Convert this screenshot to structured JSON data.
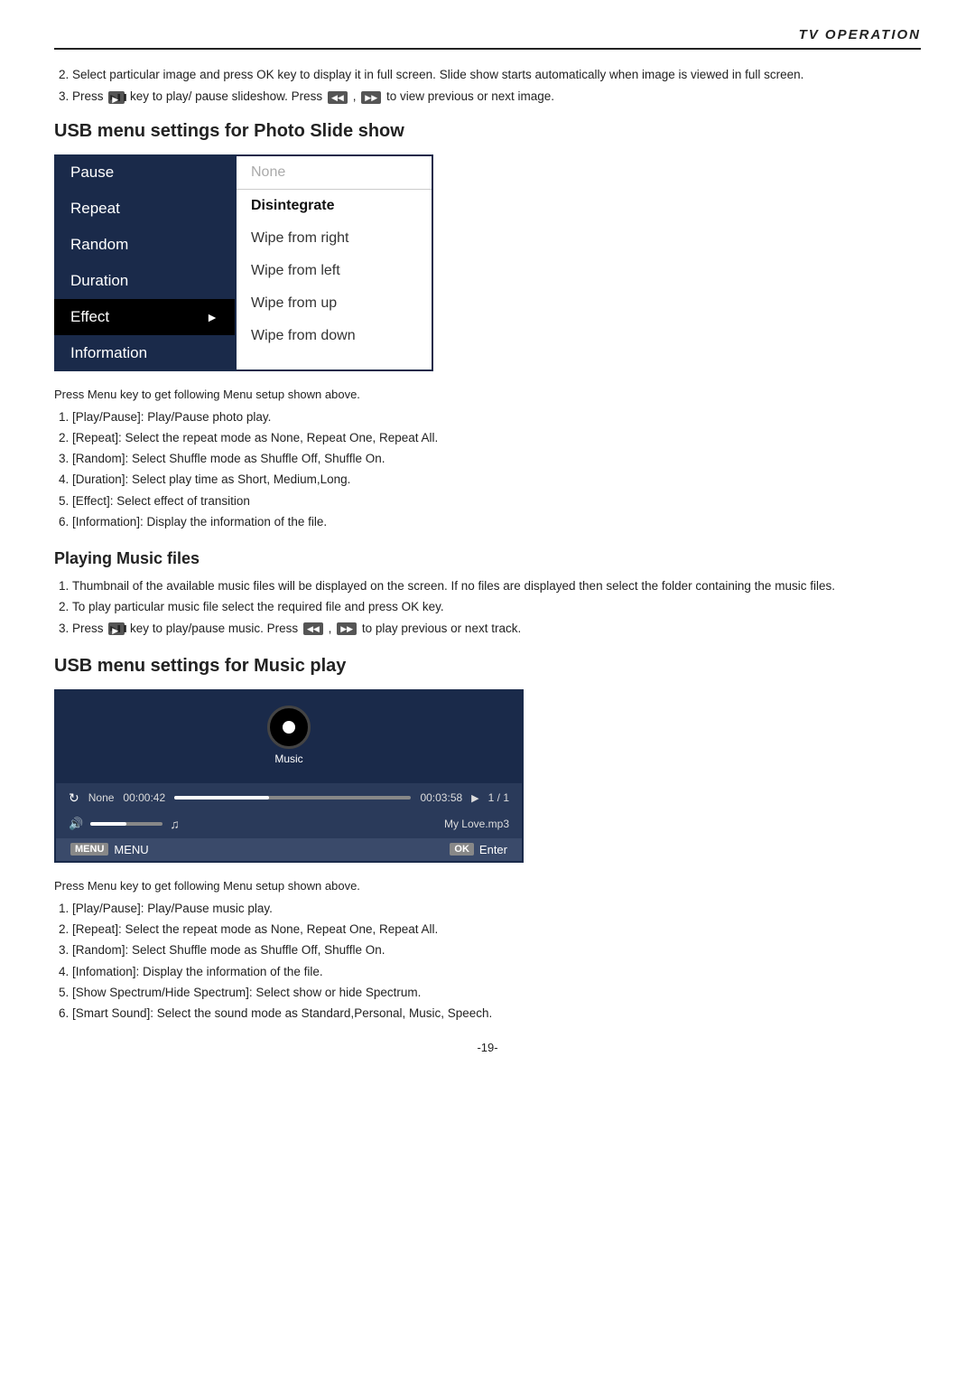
{
  "header": {
    "title": "TV OPERATION"
  },
  "intro": {
    "item2": "Select particular image and press OK key to display it in full screen.\nSlide show starts automatically when image is viewed in full screen.",
    "item3_pre": "Press",
    "item3_mid": "key to play/ pause slideshow. Press",
    "item3_post": "to view previous or next image."
  },
  "photoSection": {
    "title": "USB menu settings for Photo Slide show",
    "menuLeft": [
      {
        "label": "Pause",
        "active": false
      },
      {
        "label": "Repeat",
        "active": false
      },
      {
        "label": "Random",
        "active": false
      },
      {
        "label": "Duration",
        "active": false
      },
      {
        "label": "Effect",
        "active": true
      },
      {
        "label": "Information",
        "active": false
      }
    ],
    "menuRight": [
      {
        "label": "None",
        "type": "header"
      },
      {
        "label": "Disintegrate",
        "type": "selected"
      },
      {
        "label": "Wipe from right",
        "type": "normal"
      },
      {
        "label": "Wipe from left",
        "type": "normal"
      },
      {
        "label": "Wipe from up",
        "type": "normal"
      },
      {
        "label": "Wipe from down",
        "type": "normal"
      }
    ],
    "pressNote": "Press Menu key to get following Menu setup shown above.",
    "instructions": [
      "[Play/Pause]: Play/Pause photo play.",
      "[Repeat]: Select the repeat mode as None, Repeat One, Repeat All.",
      "[Random]: Select Shuffle mode as Shuffle Off, Shuffle On.",
      "[Duration]: Select play time as Short, Medium,Long.",
      "[Effect]: Select effect of transition",
      "[Information]: Display the information of the file."
    ]
  },
  "musicSection": {
    "subTitle": "Playing Music files",
    "items": [
      "Thumbnail of the available music files will be displayed on the screen. If no files are displayed then select the folder containing the music files.",
      "To play particular music file select the required file and press OK key.",
      "Press key to play/pause music. Press , to play previous or next track."
    ],
    "usbTitle": "USB menu settings for Music play",
    "player": {
      "discLabel": "Music",
      "repeatLabel": "None",
      "timeElapsed": "00:00:42",
      "timeDuration": "00:03:58",
      "trackNum": "1 / 1",
      "trackName": "My Love.mp3",
      "menuLabel": "MENU",
      "okLabel": "Enter"
    },
    "pressNote": "Press Menu key to get following Menu setup shown above.",
    "instructions": [
      "[Play/Pause]: Play/Pause music play.",
      "[Repeat]: Select the repeat mode as None, Repeat One, Repeat All.",
      "[Random]: Select Shuffle mode as Shuffle Off, Shuffle On.",
      "[Infomation]: Display the information of the file.",
      "[Show Spectrum/Hide Spectrum]: Select show or hide Spectrum.",
      "[Smart Sound]: Select the sound mode as Standard,Personal, Music, Speech."
    ]
  },
  "footer": {
    "pageNumber": "-19-"
  }
}
